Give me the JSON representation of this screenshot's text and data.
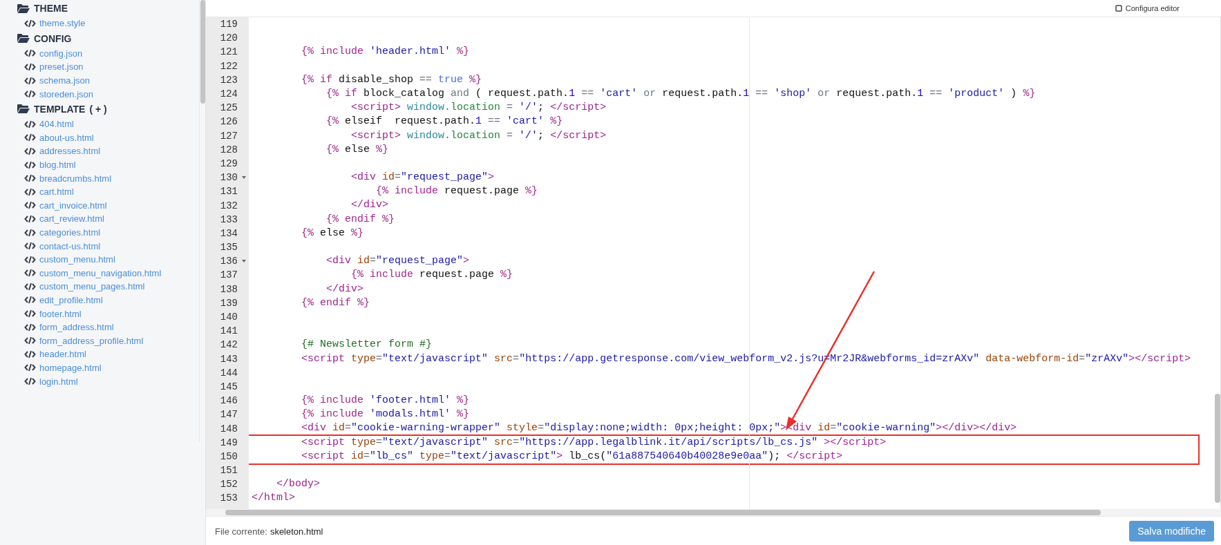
{
  "sidebar": {
    "groups": [
      {
        "title": "THEME",
        "files": [
          "theme.style"
        ]
      },
      {
        "title": "CONFIG",
        "files": [
          "config.json",
          "preset.json",
          "schema.json",
          "storeden.json"
        ]
      },
      {
        "title": "TEMPLATE",
        "action": "( + )",
        "files": [
          "404.html",
          "about-us.html",
          "addresses.html",
          "blog.html",
          "breadcrumbs.html",
          "cart.html",
          "cart_invoice.html",
          "cart_review.html",
          "categories.html",
          "contact-us.html",
          "custom_menu.html",
          "custom_menu_navigation.html",
          "custom_menu_pages.html",
          "edit_profile.html",
          "footer.html",
          "form_address.html",
          "form_address_profile.html",
          "header.html",
          "homepage.html",
          "login.html"
        ]
      }
    ]
  },
  "toolbar": {
    "label": "Configura editor"
  },
  "editor": {
    "lines": [
      {
        "number": "119",
        "fold": false,
        "boxed": false
      },
      {
        "number": "120",
        "fold": false,
        "boxed": false
      },
      {
        "number": "121",
        "fold": false,
        "boxed": false,
        "tokens": [
          {
            "kind": "delim",
            "text": "        {%"
          },
          {
            "kind": "keyword",
            "text": " include "
          },
          {
            "kind": "string",
            "text": "'header.html'"
          },
          {
            "kind": "delim",
            "text": " %}"
          }
        ]
      },
      {
        "number": "122",
        "fold": false,
        "boxed": false
      },
      {
        "number": "123",
        "fold": false,
        "boxed": false,
        "tokens": [
          {
            "kind": "delim",
            "text": "        {%"
          },
          {
            "kind": "keyword",
            "text": " if"
          },
          {
            "kind": "plain",
            "text": " disable_shop "
          },
          {
            "kind": "operator",
            "text": "=="
          },
          {
            "kind": "bool",
            "text": " true"
          },
          {
            "kind": "delim",
            "text": " %}"
          }
        ]
      },
      {
        "number": "124",
        "fold": false,
        "boxed": false,
        "tokens": [
          {
            "kind": "delim",
            "text": "            {%"
          },
          {
            "kind": "keyword",
            "text": " if"
          },
          {
            "kind": "plain",
            "text": " block_catalog "
          },
          {
            "kind": "operator",
            "text": "and"
          },
          {
            "kind": "plain",
            "text": " ( request.path."
          },
          {
            "kind": "number",
            "text": "1"
          },
          {
            "kind": "operator",
            "text": " =="
          },
          {
            "kind": "string",
            "text": " 'cart'"
          },
          {
            "kind": "operator",
            "text": " or"
          },
          {
            "kind": "plain",
            "text": " request.path."
          },
          {
            "kind": "number",
            "text": "1"
          },
          {
            "kind": "operator",
            "text": " =="
          },
          {
            "kind": "string",
            "text": " 'shop'"
          },
          {
            "kind": "operator",
            "text": " or"
          },
          {
            "kind": "plain",
            "text": " request.path."
          },
          {
            "kind": "number",
            "text": "1"
          },
          {
            "kind": "operator",
            "text": " =="
          },
          {
            "kind": "string",
            "text": " 'product'"
          },
          {
            "kind": "plain",
            "text": " ) "
          },
          {
            "kind": "delim",
            "text": "%}"
          }
        ]
      },
      {
        "number": "125",
        "fold": false,
        "boxed": false,
        "tokens": [
          {
            "kind": "tag",
            "text": "                <script>"
          },
          {
            "kind": "variable",
            "text": " window"
          },
          {
            "kind": "property",
            "text": ".location"
          },
          {
            "kind": "operator",
            "text": " ="
          },
          {
            "kind": "string",
            "text": " '/'"
          },
          {
            "kind": "plain",
            "text": "; "
          },
          {
            "kind": "tag",
            "text": "</script>"
          }
        ]
      },
      {
        "number": "126",
        "fold": false,
        "boxed": false,
        "tokens": [
          {
            "kind": "delim",
            "text": "            {%"
          },
          {
            "kind": "plain",
            "text": " elseif  request.path."
          },
          {
            "kind": "number",
            "text": "1"
          },
          {
            "kind": "operator",
            "text": " =="
          },
          {
            "kind": "string",
            "text": " 'cart'"
          },
          {
            "kind": "delim",
            "text": " %}"
          }
        ]
      },
      {
        "number": "127",
        "fold": false,
        "boxed": false,
        "tokens": [
          {
            "kind": "tag",
            "text": "                <script>"
          },
          {
            "kind": "variable",
            "text": " window"
          },
          {
            "kind": "property",
            "text": ".location"
          },
          {
            "kind": "operator",
            "text": " ="
          },
          {
            "kind": "string",
            "text": " '/'"
          },
          {
            "kind": "plain",
            "text": "; "
          },
          {
            "kind": "tag",
            "text": "</script>"
          }
        ]
      },
      {
        "number": "128",
        "fold": false,
        "boxed": false,
        "tokens": [
          {
            "kind": "delim",
            "text": "            {%"
          },
          {
            "kind": "plain",
            "text": " else "
          },
          {
            "kind": "delim",
            "text": "%}"
          }
        ]
      },
      {
        "number": "129",
        "fold": false,
        "boxed": false
      },
      {
        "number": "130",
        "fold": true,
        "boxed": false,
        "tokens": [
          {
            "kind": "tag",
            "text": "                <div"
          },
          {
            "kind": "attr",
            "text": " id"
          },
          {
            "kind": "operator",
            "text": "="
          },
          {
            "kind": "string",
            "text": "\"request_page\""
          },
          {
            "kind": "tag",
            "text": ">"
          }
        ]
      },
      {
        "number": "131",
        "fold": false,
        "boxed": false,
        "tokens": [
          {
            "kind": "delim",
            "text": "                    {%"
          },
          {
            "kind": "keyword",
            "text": " include"
          },
          {
            "kind": "plain",
            "text": " request.page "
          },
          {
            "kind": "delim",
            "text": "%}"
          }
        ]
      },
      {
        "number": "132",
        "fold": false,
        "boxed": false,
        "tokens": [
          {
            "kind": "tag",
            "text": "                </div>"
          }
        ]
      },
      {
        "number": "133",
        "fold": false,
        "boxed": false,
        "tokens": [
          {
            "kind": "delim",
            "text": "            {%"
          },
          {
            "kind": "keyword",
            "text": " endif"
          },
          {
            "kind": "delim",
            "text": " %}"
          }
        ]
      },
      {
        "number": "134",
        "fold": false,
        "boxed": false,
        "tokens": [
          {
            "kind": "delim",
            "text": "        {%"
          },
          {
            "kind": "plain",
            "text": " else "
          },
          {
            "kind": "delim",
            "text": "%}"
          }
        ]
      },
      {
        "number": "135",
        "fold": false,
        "boxed": false
      },
      {
        "number": "136",
        "fold": true,
        "boxed": false,
        "tokens": [
          {
            "kind": "tag",
            "text": "            <div"
          },
          {
            "kind": "attr",
            "text": " id"
          },
          {
            "kind": "operator",
            "text": "="
          },
          {
            "kind": "string",
            "text": "\"request_page\""
          },
          {
            "kind": "tag",
            "text": ">"
          }
        ]
      },
      {
        "number": "137",
        "fold": false,
        "boxed": false,
        "tokens": [
          {
            "kind": "delim",
            "text": "                {%"
          },
          {
            "kind": "keyword",
            "text": " include"
          },
          {
            "kind": "plain",
            "text": " request.page "
          },
          {
            "kind": "delim",
            "text": "%}"
          }
        ]
      },
      {
        "number": "138",
        "fold": false,
        "boxed": false,
        "tokens": [
          {
            "kind": "tag",
            "text": "            </div>"
          }
        ]
      },
      {
        "number": "139",
        "fold": false,
        "boxed": false,
        "tokens": [
          {
            "kind": "delim",
            "text": "        {%"
          },
          {
            "kind": "keyword",
            "text": " endif"
          },
          {
            "kind": "delim",
            "text": " %}"
          }
        ]
      },
      {
        "number": "140",
        "fold": false,
        "boxed": false
      },
      {
        "number": "141",
        "fold": false,
        "boxed": false
      },
      {
        "number": "142",
        "fold": false,
        "boxed": false,
        "tokens": [
          {
            "kind": "comment",
            "text": "        {# Newsletter form #}"
          }
        ]
      },
      {
        "number": "143",
        "fold": false,
        "boxed": false,
        "tokens": [
          {
            "kind": "tag",
            "text": "        <script"
          },
          {
            "kind": "attr",
            "text": " type"
          },
          {
            "kind": "operator",
            "text": "="
          },
          {
            "kind": "string",
            "text": "\"text/javascript\""
          },
          {
            "kind": "attr",
            "text": " src"
          },
          {
            "kind": "operator",
            "text": "="
          },
          {
            "kind": "string",
            "text": "\"https://app.getresponse.com/view_webform_v2.js?u=Mr2JR&webforms_id=zrAXv\""
          },
          {
            "kind": "attr",
            "text": " data-webform-id"
          },
          {
            "kind": "operator",
            "text": "="
          },
          {
            "kind": "string",
            "text": "\"zrAXv\""
          },
          {
            "kind": "tag",
            "text": "></script>"
          }
        ]
      },
      {
        "number": "144",
        "fold": false,
        "boxed": false
      },
      {
        "number": "145",
        "fold": false,
        "boxed": false
      },
      {
        "number": "146",
        "fold": false,
        "boxed": false,
        "tokens": [
          {
            "kind": "delim",
            "text": "        {%"
          },
          {
            "kind": "keyword",
            "text": " include "
          },
          {
            "kind": "string",
            "text": "'footer.html'"
          },
          {
            "kind": "delim",
            "text": " %}"
          }
        ]
      },
      {
        "number": "147",
        "fold": false,
        "boxed": false,
        "tokens": [
          {
            "kind": "delim",
            "text": "        {%"
          },
          {
            "kind": "keyword",
            "text": " include "
          },
          {
            "kind": "string",
            "text": "'modals.html'"
          },
          {
            "kind": "delim",
            "text": " %}"
          }
        ]
      },
      {
        "number": "148",
        "fold": false,
        "boxed": false,
        "tokens": [
          {
            "kind": "tag",
            "text": "        <div"
          },
          {
            "kind": "attr",
            "text": " id"
          },
          {
            "kind": "operator",
            "text": "="
          },
          {
            "kind": "string",
            "text": "\"cookie-warning-wrapper\""
          },
          {
            "kind": "attr",
            "text": " style"
          },
          {
            "kind": "operator",
            "text": "="
          },
          {
            "kind": "string",
            "text": "\"display:none;width: 0px;height: 0px;\""
          },
          {
            "kind": "tag",
            "text": "><div"
          },
          {
            "kind": "attr",
            "text": " id"
          },
          {
            "kind": "operator",
            "text": "="
          },
          {
            "kind": "string",
            "text": "\"cookie-warning\""
          },
          {
            "kind": "tag",
            "text": "></div></div>"
          }
        ]
      },
      {
        "number": "149",
        "fold": false,
        "boxed": true,
        "tokens": [
          {
            "kind": "tag",
            "text": "        <script"
          },
          {
            "kind": "attr",
            "text": " type"
          },
          {
            "kind": "operator",
            "text": "="
          },
          {
            "kind": "string",
            "text": "\"text/javascript\""
          },
          {
            "kind": "attr",
            "text": " src"
          },
          {
            "kind": "operator",
            "text": "="
          },
          {
            "kind": "string",
            "text": "\"https://app.legalblink.it/api/scripts/lb_cs.js\""
          },
          {
            "kind": "tag",
            "text": " ></script>"
          }
        ]
      },
      {
        "number": "150",
        "fold": false,
        "boxed": true,
        "tokens": [
          {
            "kind": "tag",
            "text": "        <script"
          },
          {
            "kind": "attr",
            "text": " id"
          },
          {
            "kind": "operator",
            "text": "="
          },
          {
            "kind": "string",
            "text": "\"lb_cs\""
          },
          {
            "kind": "attr",
            "text": " type"
          },
          {
            "kind": "operator",
            "text": "="
          },
          {
            "kind": "string",
            "text": "\"text/javascript\""
          },
          {
            "kind": "tag",
            "text": ">"
          },
          {
            "kind": "plain",
            "text": " lb_cs("
          },
          {
            "kind": "string",
            "text": "\"61a887540640b40028e9e0aa\""
          },
          {
            "kind": "plain",
            "text": "); "
          },
          {
            "kind": "tag",
            "text": "</script>"
          }
        ]
      },
      {
        "number": "151",
        "fold": false,
        "boxed": false
      },
      {
        "number": "152",
        "fold": false,
        "boxed": false,
        "tokens": [
          {
            "kind": "tag",
            "text": "    </body>"
          }
        ]
      },
      {
        "number": "153",
        "fold": false,
        "boxed": false,
        "tokens": [
          {
            "kind": "tag",
            "text": "</html>"
          }
        ]
      }
    ]
  },
  "footer": {
    "label": "File corrente:",
    "file": "skeleton.html",
    "save_button": "Salva modifiche"
  }
}
